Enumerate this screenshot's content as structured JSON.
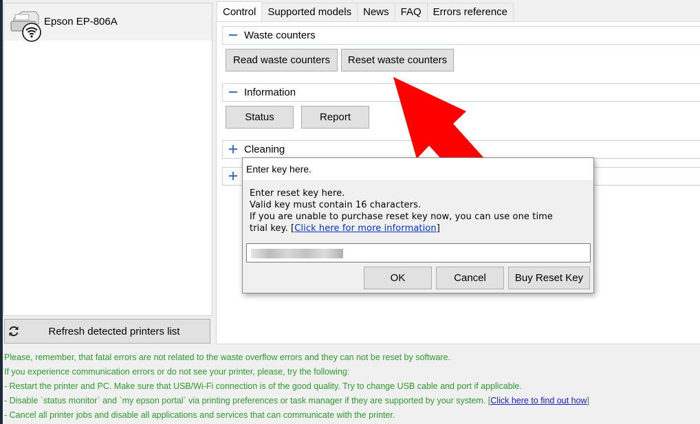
{
  "sidebar": {
    "printer_name": "Epson EP-806A",
    "refresh_label": "Refresh detected printers list"
  },
  "tabs": [
    {
      "label": "Control",
      "active": true
    },
    {
      "label": "Supported models",
      "active": false
    },
    {
      "label": "News",
      "active": false
    },
    {
      "label": "FAQ",
      "active": false
    },
    {
      "label": "Errors reference",
      "active": false
    }
  ],
  "control": {
    "waste_section": {
      "title": "Waste counters",
      "expanded": true
    },
    "read_label": "Read waste counters",
    "reset_label": "Reset waste counters",
    "info_section": {
      "title": "Information",
      "expanded": true
    },
    "status_label": "Status",
    "report_label": "Report",
    "cleaning_section": {
      "title": "Cleaning",
      "expanded": false
    }
  },
  "dialog": {
    "title": "Enter key here.",
    "line1": "Enter reset key here.",
    "line2": "Valid key must contain 16 characters.",
    "line3": "If you are unable to purchase reset key now, you can use one time",
    "line4_prefix": "trial key. [",
    "line4_link": "Click here for more information",
    "line4_suffix": "]",
    "ok_label": "OK",
    "cancel_label": "Cancel",
    "buy_label": "Buy Reset Key"
  },
  "notes": {
    "line1": "Please, remember, that fatal errors are not related to the waste overflow errors and they can not be reset by software.",
    "line2": "If you experience communication errors or do not see your printer, please, try the following:",
    "line3": "- Restart the printer and PC. Make sure that USB/Wi-Fi connection is of the good quality. Try to change USB cable and port if applicable.",
    "line4_prefix": "- Disable `status monitor` and `my epson portal` via printing preferences or task manager if they are supported by your system. [",
    "line4_link": "Click here to find out how",
    "line4_suffix": "]",
    "line5": "- Cancel all printer jobs  and disable all applications and services that can communicate with the printer."
  },
  "colors": {
    "note_green": "#2d9b2d",
    "link_blue": "#1a1acc",
    "arrow_red": "#ff0000",
    "section_border": "#c4d3e6"
  },
  "icons": {
    "printer": "printer-wifi-icon",
    "refresh": "refresh-icon",
    "collapse": "minus-icon",
    "expand": "plus-icon"
  }
}
